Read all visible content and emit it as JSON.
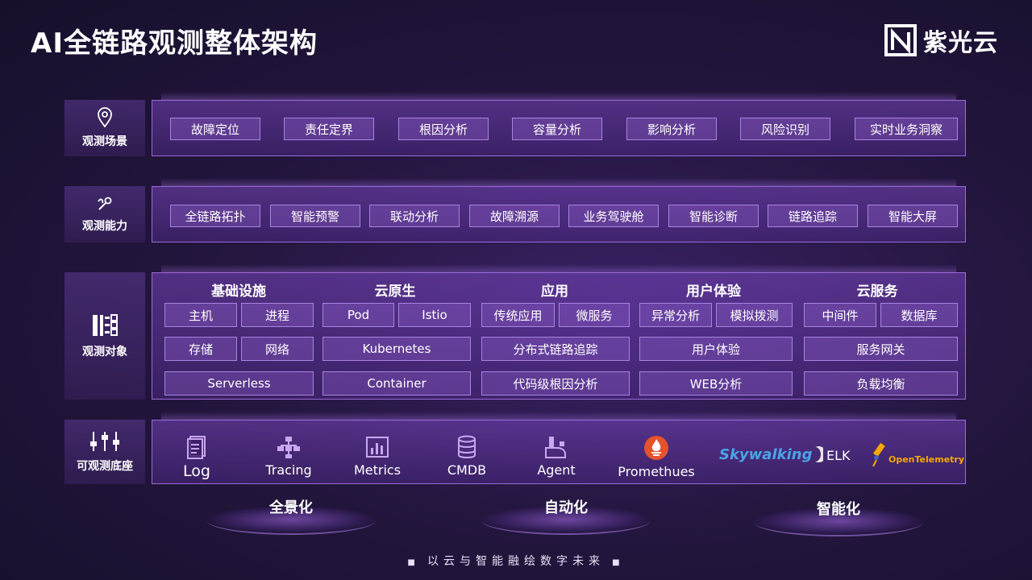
{
  "title": "AI全链路观测整体架构",
  "logo": {
    "text": "紫光云"
  },
  "rows": {
    "scenarios": {
      "label": "观测场景",
      "items": [
        "故障定位",
        "责任定界",
        "根因分析",
        "容量分析",
        "影响分析",
        "风险识别",
        "实时业务洞察"
      ]
    },
    "capabilities": {
      "label": "观测能力",
      "items": [
        "全链路拓扑",
        "智能预警",
        "联动分析",
        "故障溯源",
        "业务驾驶舱",
        "智能诊断",
        "链路追踪",
        "智能大屏"
      ]
    },
    "objects": {
      "label": "观测对象"
    },
    "foundation": {
      "label": "可观测底座"
    }
  },
  "objects": {
    "infra": {
      "title": "基础设施",
      "items": [
        "主机",
        "进程",
        "存储",
        "网络",
        "Serverless"
      ]
    },
    "cloudnative": {
      "title": "云原生",
      "items": [
        "Pod",
        "Istio",
        "Kubernetes",
        "Container"
      ]
    },
    "app": {
      "title": "应用",
      "items": [
        "传统应用",
        "微服务",
        "分布式链路追踪",
        "代码级根因分析"
      ]
    },
    "ux": {
      "title": "用户体验",
      "items": [
        "异常分析",
        "模拟拨测",
        "用户体验",
        "WEB分析"
      ]
    },
    "cloudsvc": {
      "title": "云服务",
      "items": [
        "中间件",
        "数据库",
        "服务网关",
        "负载均衡"
      ]
    }
  },
  "sources": [
    "Log",
    "Tracing",
    "Metrics",
    "CMDB",
    "Agent",
    "Promethues"
  ],
  "brands": {
    "skywalking": "Skywalking",
    "elk": "ELK",
    "otel": "OpenTelemetry"
  },
  "platforms": [
    "全景化",
    "自动化",
    "智能化"
  ],
  "footer": "以云与智能融绘数字未来",
  "colors": {
    "accent": "#9b6ad6",
    "background": "#24163f"
  }
}
